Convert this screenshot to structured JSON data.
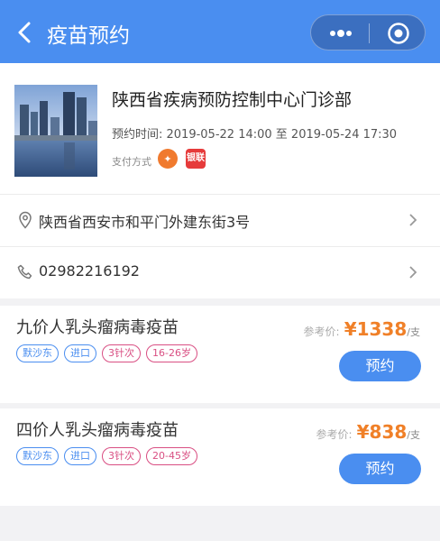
{
  "header": {
    "title": "疫苗预约",
    "back_icon": "chevron-left-icon",
    "more_icon": "more-dots-icon",
    "close_icon": "target-circle-icon"
  },
  "hospital": {
    "name": "陕西省疾病预防控制中心门诊部",
    "time_label": "预约时间: 2019-05-22 14:00 至 2019-05-24 17:30",
    "pay_label": "支付方式",
    "pay_icons": [
      "payment-app-icon",
      "unionpay-icon"
    ],
    "pay_icon_a_text": "",
    "pay_icon_b_text": "银联"
  },
  "address": {
    "icon": "location-pin-icon",
    "text": "陕西省西安市和平门外建东街3号"
  },
  "phone": {
    "icon": "phone-icon",
    "text": "02982216192"
  },
  "vaccines": [
    {
      "name": "九价人乳头瘤病毒疫苗",
      "tags": [
        "默沙东",
        "进口",
        "3针次",
        "16-26岁"
      ],
      "price_label": "参考价:",
      "price": "¥1338",
      "unit": "/支",
      "button": "预约"
    },
    {
      "name": "四价人乳头瘤病毒疫苗",
      "tags": [
        "默沙东",
        "进口",
        "3针次",
        "20-45岁"
      ],
      "price_label": "参考价:",
      "price": "¥838",
      "unit": "/支",
      "button": "预约"
    }
  ],
  "colors": {
    "primary": "#4a8ef0",
    "price": "#f08028",
    "tag_pink": "#d94f83"
  }
}
